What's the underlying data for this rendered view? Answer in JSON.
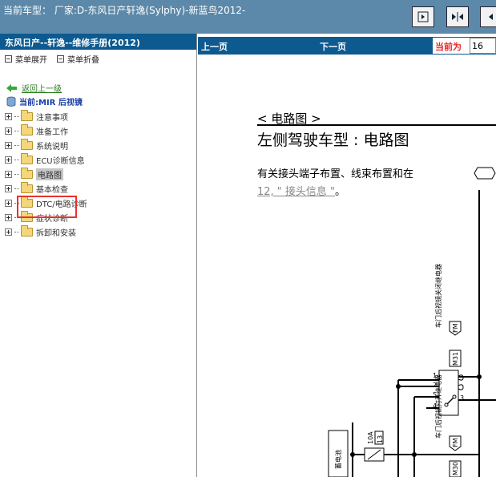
{
  "header": {
    "title": "当前车型： 厂家:D-东风日产轩逸(Sylphy)-新蓝鸟2012-",
    "buttons": [
      "first-page-icon",
      "expand-icon",
      "prev-icon"
    ]
  },
  "sidebar": {
    "manual_title": "东风日产--轩逸--维修手册(2012)",
    "expand_label": "菜单展开",
    "collapse_label": "菜单折叠",
    "back_label": "返回上一级",
    "current_label": "当前:MIR 后视镜",
    "items": [
      {
        "label": "注意事项"
      },
      {
        "label": "准备工作"
      },
      {
        "label": "系统说明"
      },
      {
        "label": "ECU诊断信息"
      },
      {
        "label": "电路图"
      },
      {
        "label": "基本检查"
      },
      {
        "label": "DTC/电路诊断"
      },
      {
        "label": "症状诊断"
      },
      {
        "label": "拆卸和安装"
      }
    ],
    "selected_index": 4
  },
  "nav": {
    "prev_label": "上一页",
    "next_label": "下一页",
    "current_label": "当前为",
    "page_value": "16"
  },
  "document": {
    "section": "< 电路图 >",
    "title": "左侧驾驶车型 : 电路图",
    "paragraph": "有关接头端子布置、线束布置和在",
    "link_text": "12, \" 接头信息 \"",
    "link_suffix": "。"
  },
  "diagram": {
    "switch1_label": "车门后视镜关闭继电器",
    "switch1_code": "M31",
    "switch2_label": "车门后视镜打开继电器",
    "switch2_code": "M30",
    "fm_tag": "FM",
    "fuse_rating": "10A",
    "fuse_num": "13",
    "battery_label": "蓄电池",
    "pin_labels_top": [
      "1",
      "2",
      "5",
      "3",
      "4"
    ],
    "pin_labels_bottom": [
      "1",
      "2",
      "5",
      "3"
    ]
  },
  "colors": {
    "topbar": "#5c89a9",
    "panel_header": "#0c5a8f",
    "highlight": "#e8322d",
    "link": "#2b7a1f"
  }
}
